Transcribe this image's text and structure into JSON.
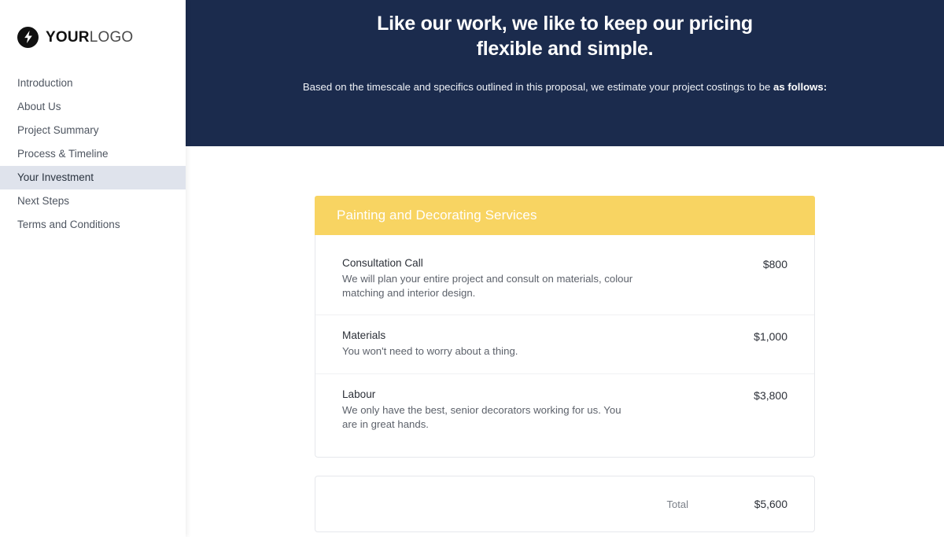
{
  "sidebar": {
    "logo": {
      "icon": "lightning-bolt-icon",
      "text_bold": "YOUR",
      "text_light": "LOGO"
    },
    "items": [
      {
        "label": "Introduction",
        "active": false
      },
      {
        "label": "About Us",
        "active": false
      },
      {
        "label": "Project Summary",
        "active": false
      },
      {
        "label": "Process & Timeline",
        "active": false
      },
      {
        "label": "Your Investment",
        "active": true
      },
      {
        "label": "Next Steps",
        "active": false
      },
      {
        "label": "Terms and Conditions",
        "active": false
      }
    ]
  },
  "hero": {
    "background_color": "#1b2b4d",
    "title_line1": "Like our work, we like to keep our pricing",
    "title_line2": "flexible and simple.",
    "subtitle_normal": "Based on the timescale and specifics outlined in this proposal, we estimate your project costings to be ",
    "subtitle_bold": "as follows:"
  },
  "pricing": {
    "header_color": "#f8d462",
    "header_title": "Painting and Decorating Services",
    "items": [
      {
        "name": "Consultation Call",
        "description": "We will plan your entire project and consult on materials, colour matching and interior design.",
        "price": "$800"
      },
      {
        "name": "Materials",
        "description": "You won't need to worry about a thing.",
        "price": "$1,000"
      },
      {
        "name": "Labour",
        "description": "We only have the best, senior decorators working for us. You are in great hands.",
        "price": "$3,800"
      }
    ],
    "total_label": "Total",
    "total_value": "$5,600"
  }
}
